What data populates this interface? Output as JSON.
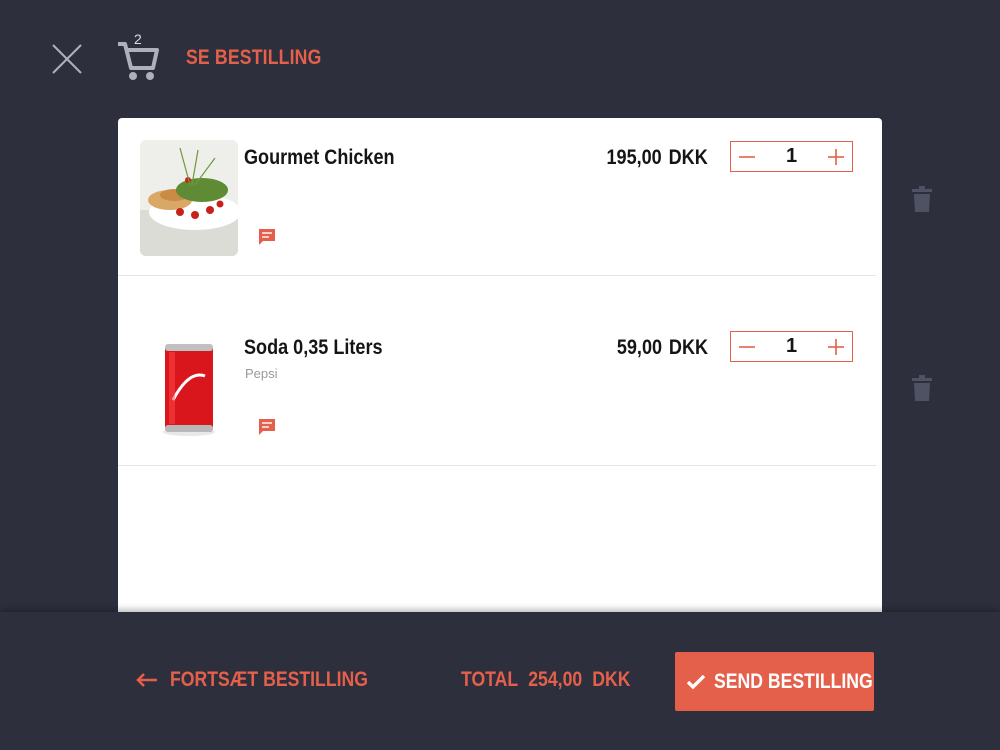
{
  "header": {
    "cart_count": "2",
    "title": "SE BESTILLING",
    "icons": {
      "close": "close-icon",
      "cart": "cart-icon"
    }
  },
  "items": [
    {
      "name": "Gourmet Chicken",
      "subtitle": "",
      "price": "195,00",
      "currency": "DKK",
      "quantity": "1",
      "image": "chicken-dish-image"
    },
    {
      "name": "Soda 0,35 Liters",
      "subtitle": "Pepsi",
      "price": "59,00",
      "currency": "DKK",
      "quantity": "1",
      "image": "soda-can-image"
    }
  ],
  "footer": {
    "continue_label": "FORTSÆT BESTILLING",
    "total_label": "TOTAL",
    "total_value": "254,00",
    "total_currency": "DKK",
    "send_label": "SEND BESTILLING"
  },
  "colors": {
    "background": "#2e2f3d",
    "accent": "#e4604a",
    "panel": "#ffffff"
  }
}
